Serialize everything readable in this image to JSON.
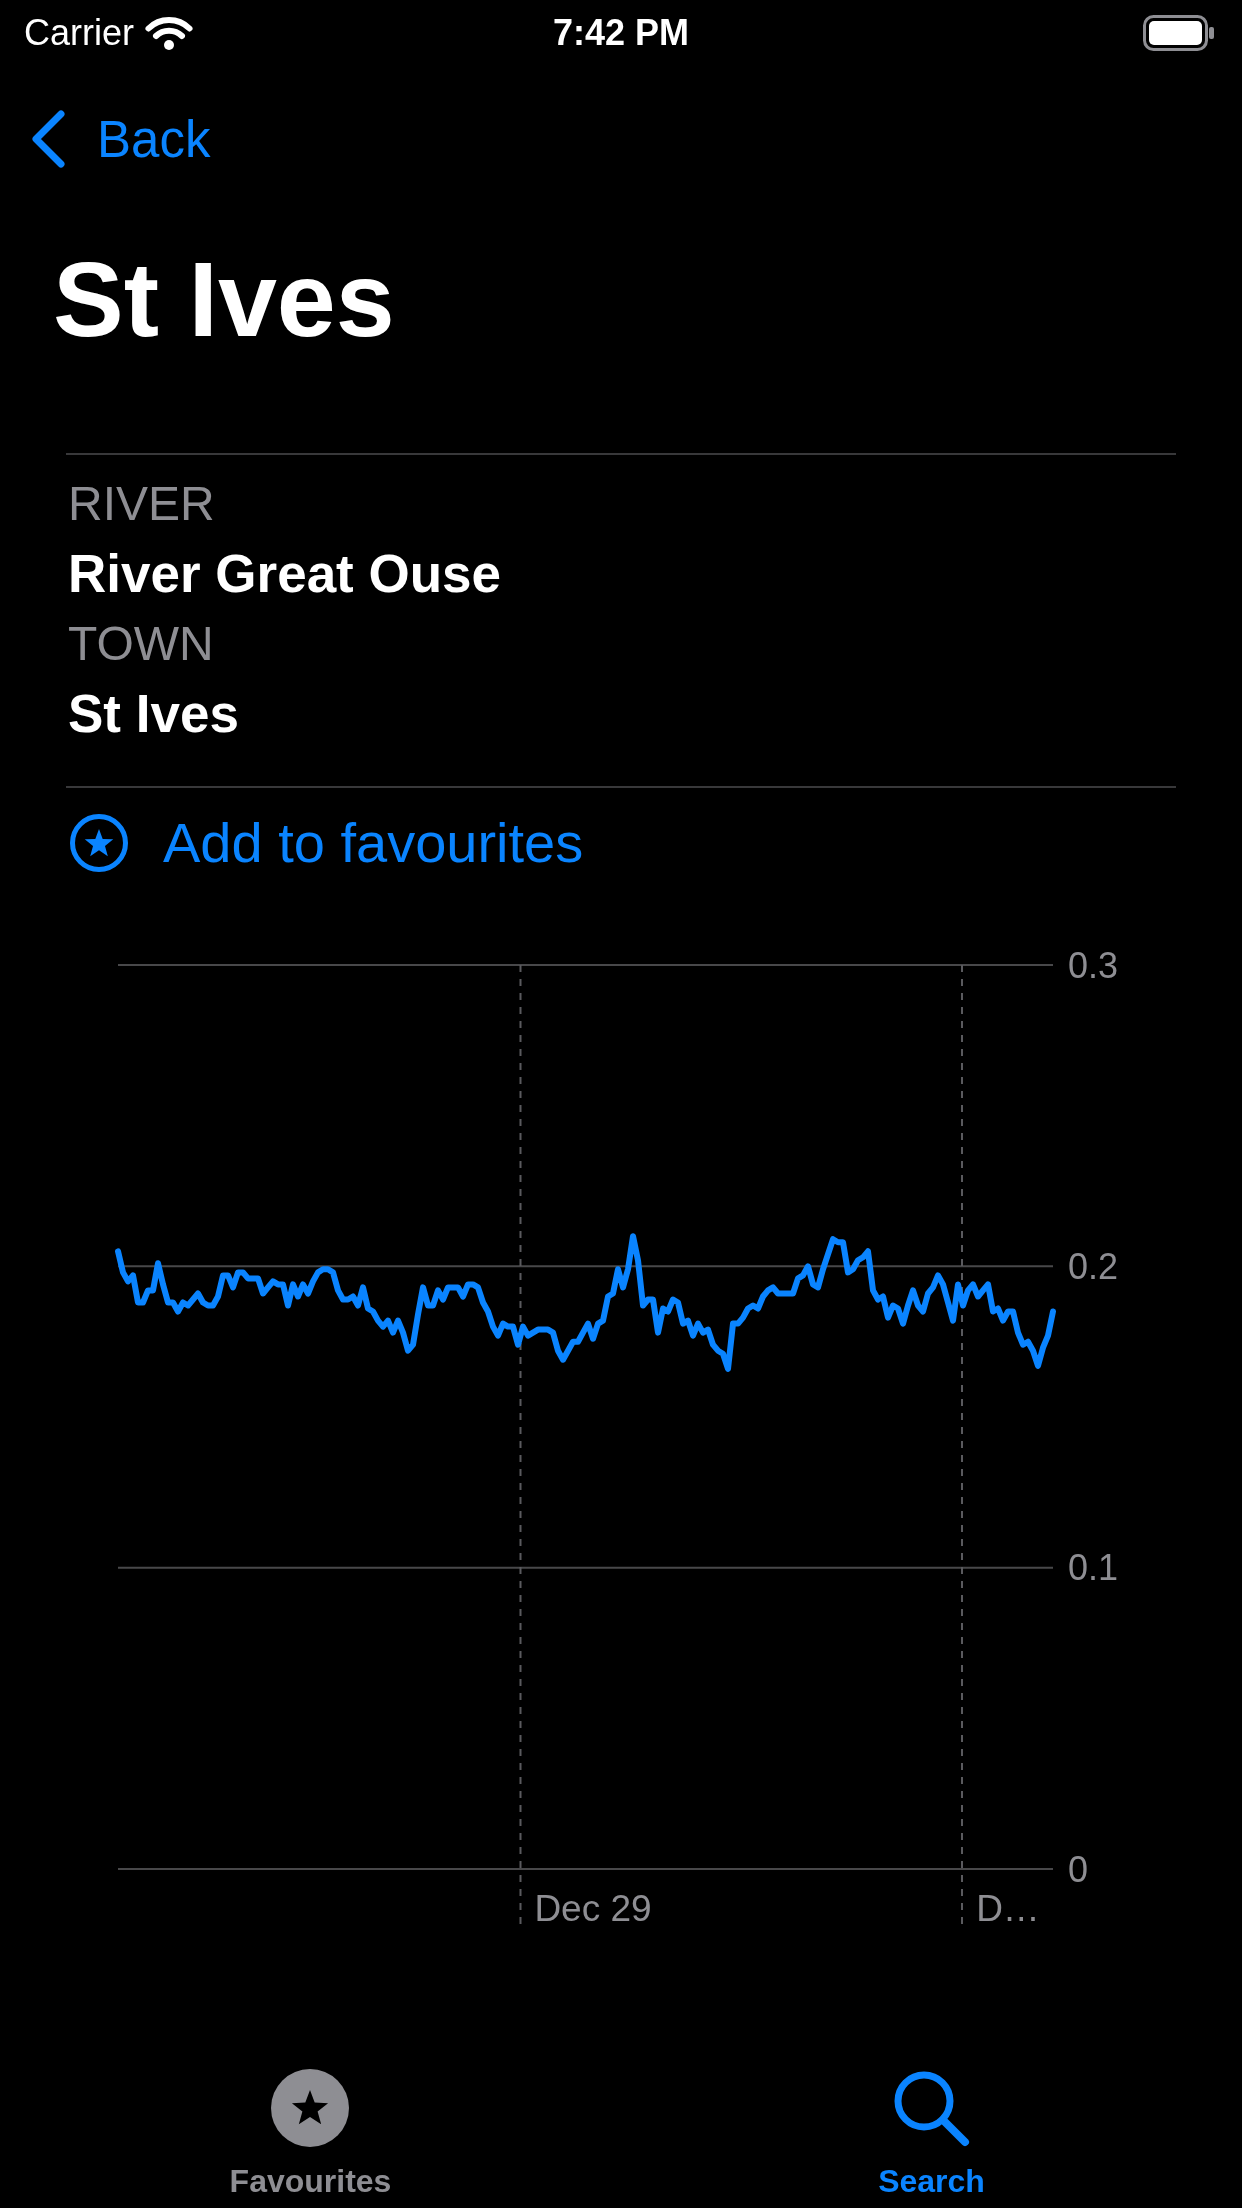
{
  "status_bar": {
    "carrier": "Carrier",
    "time": "7:42 PM"
  },
  "nav": {
    "back": "Back"
  },
  "title": "St Ives",
  "details": [
    {
      "label": "RIVER",
      "value": "River Great Ouse"
    },
    {
      "label": "TOWN",
      "value": "St Ives"
    }
  ],
  "favourite_action": {
    "label": "Add to favourites"
  },
  "chart": {
    "chart_data": {
      "type": "line",
      "categories": [
        null,
        null,
        null,
        null,
        null,
        null,
        null,
        null,
        null,
        null,
        null,
        null,
        null,
        null,
        null,
        null,
        null,
        null,
        null,
        null,
        null,
        null,
        null,
        null,
        null,
        null,
        null,
        null,
        null,
        null,
        null,
        null,
        null,
        null,
        null,
        null,
        null,
        null,
        null,
        null,
        null,
        null,
        null,
        null,
        null,
        null,
        null,
        null,
        null,
        null,
        null,
        null,
        null,
        null,
        null,
        null,
        null,
        null,
        null,
        null,
        null,
        null,
        null,
        null,
        null,
        null,
        null,
        null,
        null,
        null,
        null,
        null,
        null,
        null,
        null,
        null,
        null,
        null,
        null,
        null,
        null,
        null,
        null,
        null,
        null,
        null,
        null,
        null,
        null,
        null,
        null,
        null,
        null,
        null,
        null,
        "Dec 29",
        null,
        null,
        null,
        null,
        null,
        null,
        null,
        null,
        null,
        null,
        null,
        null,
        null,
        null,
        null,
        null,
        null,
        null,
        null,
        null,
        null,
        null,
        null,
        null,
        null,
        null,
        null,
        null,
        null,
        null,
        null,
        null,
        null,
        null,
        null,
        null,
        null,
        null,
        null,
        null,
        null,
        null,
        null,
        null,
        null,
        null,
        null,
        null,
        null,
        null,
        null,
        null,
        null,
        null,
        null,
        null,
        null,
        null,
        null,
        null,
        null,
        null,
        null,
        null,
        null,
        null,
        null,
        null,
        null,
        null,
        null,
        null,
        null,
        null,
        null,
        null,
        null,
        null,
        null,
        null,
        null,
        null,
        "D…",
        null,
        null,
        null,
        null,
        null,
        null,
        null,
        null,
        null
      ],
      "series": [
        {
          "color": "#0a84ff",
          "values": [
            0.205,
            0.198,
            0.195,
            0.197,
            0.188,
            0.188,
            0.192,
            0.192,
            0.201,
            0.194,
            0.188,
            0.188,
            0.185,
            0.188,
            0.187,
            0.189,
            0.191,
            0.188,
            0.187,
            0.187,
            0.19,
            0.197,
            0.197,
            0.193,
            0.198,
            0.198,
            0.196,
            0.196,
            0.196,
            0.191,
            0.193,
            0.195,
            0.194,
            0.194,
            0.187,
            0.194,
            0.19,
            0.194,
            0.191,
            0.195,
            0.198,
            0.199,
            0.199,
            0.198,
            0.192,
            0.189,
            0.189,
            0.19,
            0.187,
            0.193,
            0.186,
            0.185,
            0.182,
            0.18,
            0.182,
            0.178,
            0.182,
            0.178,
            0.172,
            0.174,
            0.184,
            0.193,
            0.187,
            0.187,
            0.192,
            0.189,
            0.193,
            0.193,
            0.193,
            0.19,
            0.194,
            0.194,
            0.193,
            0.188,
            0.185,
            0.18,
            0.177,
            0.181,
            0.18,
            0.18,
            0.174,
            0.18,
            0.177,
            0.178,
            0.179,
            0.179,
            0.179,
            0.178,
            0.172,
            0.169,
            0.172,
            0.175,
            0.175,
            0.178,
            0.181,
            0.176,
            0.181,
            0.182,
            0.19,
            0.191,
            0.199,
            0.193,
            0.199,
            0.21,
            0.202,
            0.187,
            0.189,
            0.189,
            0.178,
            0.186,
            0.185,
            0.189,
            0.188,
            0.181,
            0.182,
            0.177,
            0.181,
            0.178,
            0.179,
            0.174,
            0.172,
            0.171,
            0.166,
            0.181,
            0.181,
            0.183,
            0.186,
            0.187,
            0.186,
            0.19,
            0.192,
            0.193,
            0.191,
            0.191,
            0.191,
            0.191,
            0.196,
            0.197,
            0.2,
            0.194,
            0.193,
            0.199,
            0.204,
            0.209,
            0.208,
            0.208,
            0.198,
            0.199,
            0.202,
            0.203,
            0.205,
            0.192,
            0.189,
            0.19,
            0.183,
            0.187,
            0.186,
            0.181,
            0.187,
            0.192,
            0.187,
            0.185,
            0.191,
            0.193,
            0.197,
            0.194,
            0.188,
            0.182,
            0.194,
            0.187,
            0.192,
            0.194,
            0.19,
            0.192,
            0.194,
            0.185,
            0.186,
            0.182,
            0.185,
            0.185,
            0.178,
            0.174,
            0.175,
            0.172,
            0.167,
            0.173,
            0.177,
            0.185
          ]
        }
      ],
      "ylim": [
        0,
        0.3
      ],
      "yticks": [
        0,
        0.1,
        0.2,
        0.3
      ]
    }
  },
  "tab_bar": {
    "tabs": [
      {
        "label": "Favourites",
        "selected": false
      },
      {
        "label": "Search",
        "selected": true
      }
    ]
  }
}
